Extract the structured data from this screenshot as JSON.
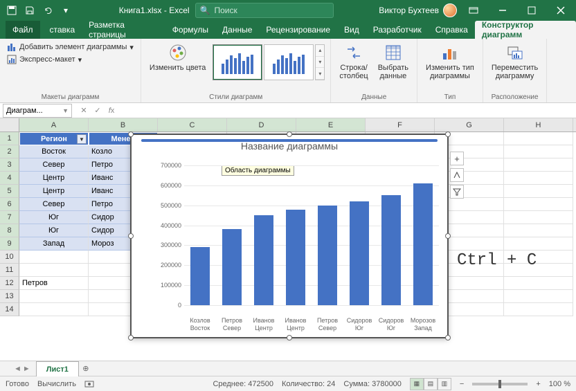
{
  "titlebar": {
    "filename": "Книга1.xlsx - Excel",
    "search_placeholder": "Поиск",
    "user": "Виктор Бухтеев"
  },
  "ribbon": {
    "tabs": [
      "Файл",
      "ставка",
      "Разметка страницы",
      "Формулы",
      "Данные",
      "Рецензирование",
      "Вид",
      "Разработчик",
      "Справка",
      "Конструктор диаграмм"
    ],
    "groups": {
      "layouts": {
        "label": "Макеты диаграмм",
        "add_element": "Добавить элемент диаграммы",
        "express": "Экспресс-макет"
      },
      "styles": {
        "label": "Стили диаграмм",
        "colors": "Изменить цвета"
      },
      "data": {
        "label": "Данные",
        "switch": "Строка/\nстолбец",
        "select": "Выбрать\nданные"
      },
      "type": {
        "label": "Тип",
        "change": "Изменить тип\nдиаграммы"
      },
      "location": {
        "label": "Расположение",
        "move": "Переместить\nдиаграмму"
      }
    }
  },
  "namebox": "Диаграм...",
  "columns": [
    "A",
    "B",
    "C",
    "D",
    "E",
    "F",
    "G",
    "H"
  ],
  "table": {
    "headers": [
      "Регион",
      "Менед"
    ],
    "rows": [
      [
        "Восток",
        "Козло"
      ],
      [
        "Север",
        "Петро"
      ],
      [
        "Центр",
        "Иванс"
      ],
      [
        "Центр",
        "Иванс"
      ],
      [
        "Север",
        "Петро"
      ],
      [
        "Юг",
        "Сидор"
      ],
      [
        "Юг",
        "Сидор"
      ],
      [
        "Запад",
        "Мороз"
      ]
    ],
    "extra_cell": "Петров"
  },
  "chart_data": {
    "type": "bar",
    "title": "Название диаграммы",
    "tooltip": "Область диаграммы",
    "ylim": [
      0,
      700000
    ],
    "y_ticks": [
      0,
      100000,
      200000,
      300000,
      400000,
      500000,
      600000,
      700000
    ],
    "categories_top": [
      "Козлов",
      "Петров",
      "Иванов",
      "Иванов",
      "Петров",
      "Сидоров",
      "Сидоров",
      "Морозов"
    ],
    "categories_bottom": [
      "Восток",
      "Север",
      "Центр",
      "Центр",
      "Север",
      "Юг",
      "Юг",
      "Запад"
    ],
    "values": [
      290000,
      380000,
      450000,
      480000,
      500000,
      520000,
      550000,
      610000
    ]
  },
  "overlay_text": "Ctrl + C",
  "sheet": {
    "name": "Лист1"
  },
  "statusbar": {
    "ready": "Готово",
    "calc": "Вычислить",
    "avg_label": "Среднее:",
    "avg": "472500",
    "count_label": "Количество:",
    "count": "24",
    "sum_label": "Сумма:",
    "sum": "3780000",
    "zoom": "100 %"
  }
}
